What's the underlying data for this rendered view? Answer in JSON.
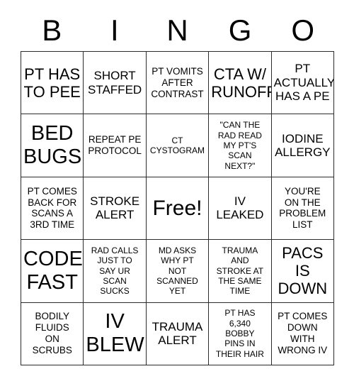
{
  "card": {
    "header_letters": [
      "B",
      "I",
      "N",
      "G",
      "O"
    ],
    "background_color": "#ffffff",
    "border_color": "#2b2b2b",
    "text_color": "#000000",
    "rows": 5,
    "columns": 5,
    "cells": [
      {
        "text": "PT HAS\nTO PEE",
        "size": "lg"
      },
      {
        "text": "SHORT\nSTAFFED",
        "size": "md"
      },
      {
        "text": "PT VOMITS\nAFTER\nCONTRAST",
        "size": "sm"
      },
      {
        "text": "CTA W/\nRUNOFF",
        "size": "lg"
      },
      {
        "text": "PT\nACTUALLY\nHAS A PE",
        "size": "md"
      },
      {
        "text": "BED\nBUGS",
        "size": "xl"
      },
      {
        "text": "REPEAT PE\nPROTOCOL",
        "size": "sm"
      },
      {
        "text": "CT\nCYSTOGRAM",
        "size": "xs"
      },
      {
        "text": "\"CAN THE\nRAD READ\nMY PT'S\nSCAN\nNEXT?\"",
        "size": "xs"
      },
      {
        "text": "IODINE\nALLERGY",
        "size": "md"
      },
      {
        "text": "PT COMES\nBACK FOR\nSCANS A\n3RD TIME",
        "size": "sm"
      },
      {
        "text": "STROKE\nALERT",
        "size": "md"
      },
      {
        "text": "Free!",
        "size": "free"
      },
      {
        "text": "IV\nLEAKED",
        "size": "md"
      },
      {
        "text": "YOU'RE\nON THE\nPROBLEM\nLIST",
        "size": "sm"
      },
      {
        "text": "CODE\nFAST",
        "size": "xl"
      },
      {
        "text": "RAD CALLS\nJUST TO\nSAY UR\nSCAN\nSUCKS",
        "size": "xs"
      },
      {
        "text": "MD ASKS\nWHY PT\nNOT\nSCANNED\nYET",
        "size": "xs"
      },
      {
        "text": "TRAUMA\nAND\nSTROKE AT\nTHE SAME\nTIME",
        "size": "xs"
      },
      {
        "text": "PACS\nIS\nDOWN",
        "size": "lg"
      },
      {
        "text": "BODILY\nFLUIDS\nON\nSCRUBS",
        "size": "sm"
      },
      {
        "text": "IV\nBLEW",
        "size": "xl"
      },
      {
        "text": "TRAUMA\nALERT",
        "size": "md"
      },
      {
        "text": "PT HAS\n6,340\nBOBBY\nPINS IN\nTHEIR HAIR",
        "size": "xs"
      },
      {
        "text": "PT COMES\nDOWN\nWITH\nWRONG IV",
        "size": "sm"
      }
    ]
  }
}
